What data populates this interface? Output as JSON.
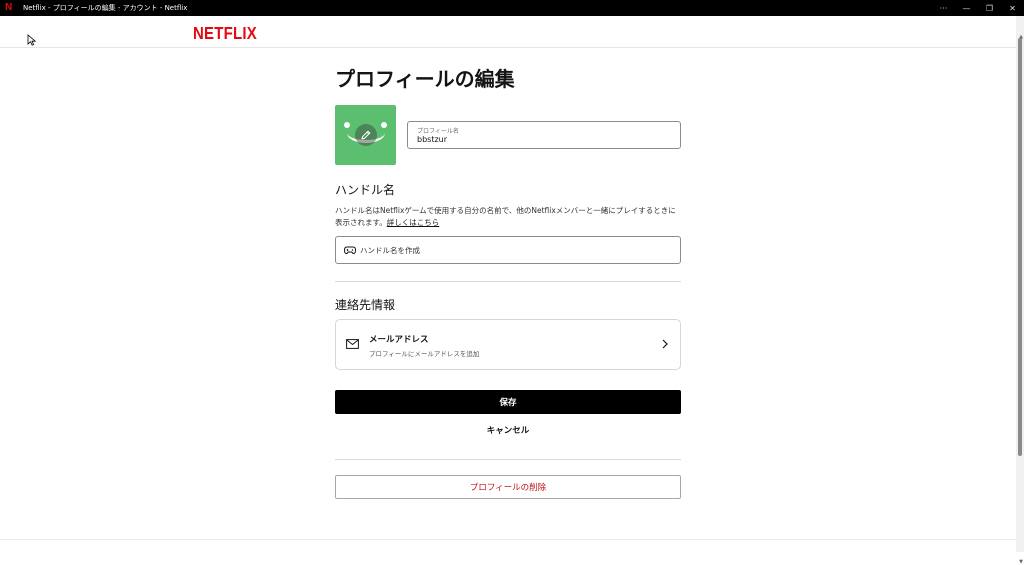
{
  "window": {
    "title": "Netflix - プロフィールの編集 - アカウント - Netflix",
    "controls": {
      "more": "···",
      "minimize": "—",
      "restore": "❐",
      "close": "✕"
    }
  },
  "header": {
    "logo": "NETFLIX"
  },
  "main": {
    "title": "プロフィールの編集",
    "profile_name": {
      "label": "プロフィール名",
      "value": "bbstzur"
    },
    "handle": {
      "title": "ハンドル名",
      "description": "ハンドル名はNetflixゲームで使用する自分の名前で、他のNetflixメンバーと一緒にプレイするときに表示されます。",
      "link": "詳しくはこちら",
      "placeholder": "ハンドル名を作成",
      "icon": "gamepad-icon"
    },
    "contact": {
      "title": "連絡先情報",
      "email_title": "メールアドレス",
      "email_subtitle": "プロフィールにメールアドレスを追加",
      "icon": "mail-icon"
    },
    "save_label": "保存",
    "cancel_label": "キャンセル",
    "delete_label": "プロフィールの削除"
  },
  "colors": {
    "brand": "#e50914",
    "avatar": "#5cbf6f",
    "danger": "#c11119",
    "primary_button": "#000000"
  }
}
